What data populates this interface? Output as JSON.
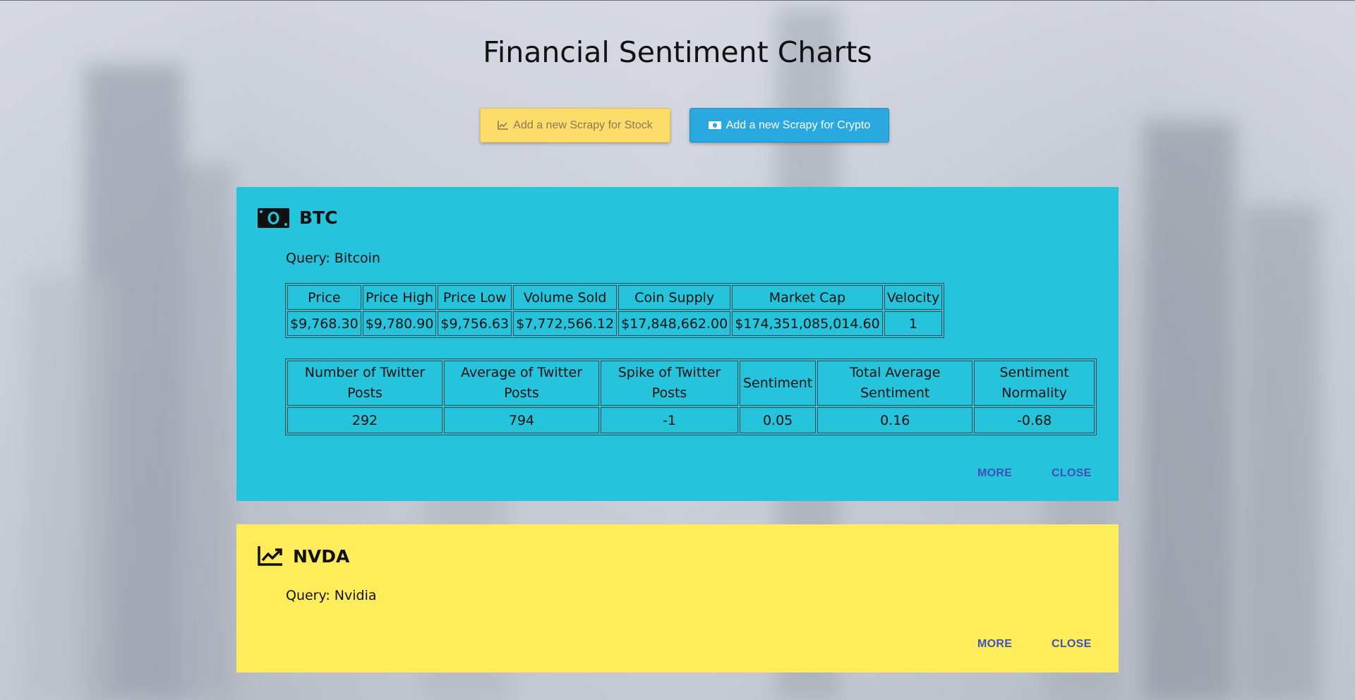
{
  "page": {
    "title": "Financial Sentiment Charts"
  },
  "buttons": {
    "stock_label": "Add a new Scrapy for Stock",
    "crypto_label": "Add a new Scrapy for Crypto"
  },
  "cards": [
    {
      "symbol": "BTC",
      "icon": "money-bill-icon",
      "color": "#25c4dc",
      "query": "Query: Bitcoin",
      "market_table": {
        "headers": [
          "Price",
          "Price High",
          "Price Low",
          "Volume Sold",
          "Coin Supply",
          "Market Cap",
          "Velocity"
        ],
        "values": [
          "$9,768.30",
          "$9,780.90",
          "$9,756.63",
          "$7,772,566.12",
          "$17,848,662.00",
          "$174,351,085,014.60",
          "1"
        ]
      },
      "sentiment_table": {
        "headers": [
          "Number of Twitter Posts",
          "Average of Twitter Posts",
          "Spike of Twitter Posts",
          "Sentiment",
          "Total Average Sentiment",
          "Sentiment Normality"
        ],
        "values": [
          "292",
          "794",
          "-1",
          "0.05",
          "0.16",
          "-0.68"
        ]
      },
      "more_label": "MORE",
      "close_label": "CLOSE"
    },
    {
      "symbol": "NVDA",
      "icon": "chart-line-icon",
      "color": "#ffec5a",
      "query": "Query: Nvidia",
      "more_label": "MORE",
      "close_label": "CLOSE"
    }
  ]
}
